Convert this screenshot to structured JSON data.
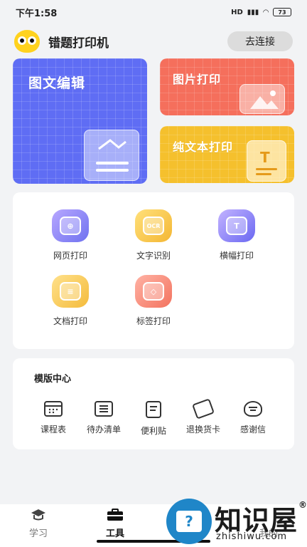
{
  "status_bar": {
    "time": "下午1:58",
    "network": "HD",
    "battery": "73"
  },
  "header": {
    "app_name": "错题打印机",
    "connect_label": "去连接"
  },
  "feature_cards": {
    "edit": "图文编辑",
    "image_print": "图片打印",
    "text_print": "纯文本打印"
  },
  "tools": {
    "web_print": {
      "label": "网页打印",
      "glyph": "⊕"
    },
    "ocr": {
      "label": "文字识别",
      "glyph": "OCR"
    },
    "banner": {
      "label": "横幅打印",
      "glyph": "T"
    },
    "doc_print": {
      "label": "文档打印",
      "glyph": "≡"
    },
    "tag_print": {
      "label": "标签打印",
      "glyph": "◇"
    }
  },
  "templates": {
    "title": "模版中心",
    "items": [
      "课程表",
      "待办清单",
      "便利贴",
      "退换货卡",
      "感谢信"
    ]
  },
  "tabbar": {
    "items": [
      "学习",
      "工具",
      "我的"
    ]
  },
  "watermark": {
    "brand": "知识屋",
    "site": "zhishiwu.com",
    "mark": "®"
  }
}
